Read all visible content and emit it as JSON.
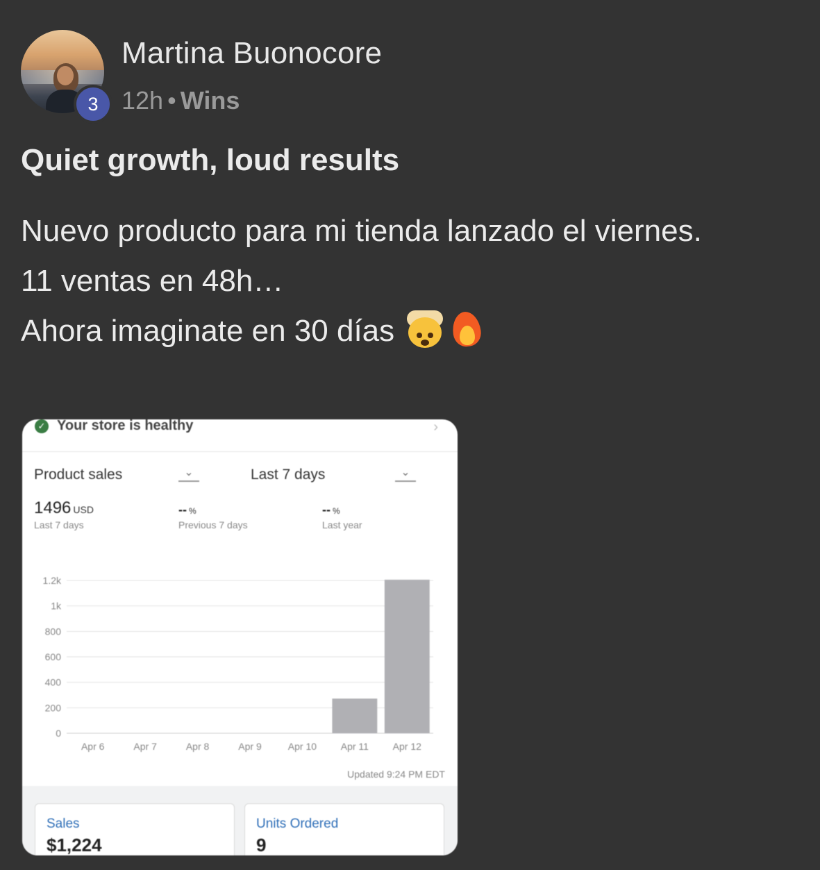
{
  "post": {
    "author": "Martina Buonocore",
    "level": "3",
    "time": "12h",
    "separator": "•",
    "category": "Wins",
    "title": "Quiet growth, loud results",
    "body_lines": [
      "Nuevo producto para mi tienda lanzado el viernes.",
      "11 ventas en 48h…",
      "Ahora imaginate en 30 días"
    ],
    "emojis": [
      "exploding-head-icon",
      "fire-icon"
    ]
  },
  "screenshot": {
    "health_text": "Your store is healthy",
    "metric_select": "Product sales",
    "range_select": "Last 7 days",
    "stats": [
      {
        "value": "1496",
        "unit": "USD",
        "label": "Last 7 days"
      },
      {
        "value": "--",
        "unit": "%",
        "label": "Previous 7 days"
      },
      {
        "value": "--",
        "unit": "%",
        "label": "Last year"
      }
    ],
    "updated": "Updated 9:24 PM EDT",
    "cards": [
      {
        "label": "Sales",
        "value": "$1,224"
      },
      {
        "label": "Units Ordered",
        "value": "9"
      }
    ],
    "colors": {
      "bar": "#b0b0b4",
      "link": "#2f6fb8",
      "check": "#3a7d44"
    }
  },
  "chart_data": {
    "type": "bar",
    "categories": [
      "Apr 6",
      "Apr 7",
      "Apr 8",
      "Apr 9",
      "Apr 10",
      "Apr 11",
      "Apr 12"
    ],
    "values": [
      0,
      0,
      0,
      0,
      0,
      272,
      1224
    ],
    "ylim": [
      0,
      1200
    ],
    "yticks": [
      0,
      200,
      400,
      600,
      800,
      1000,
      1200
    ],
    "ytick_labels": [
      "0",
      "200",
      "400",
      "600",
      "800",
      "1k",
      "1.2k"
    ],
    "grid": true
  }
}
